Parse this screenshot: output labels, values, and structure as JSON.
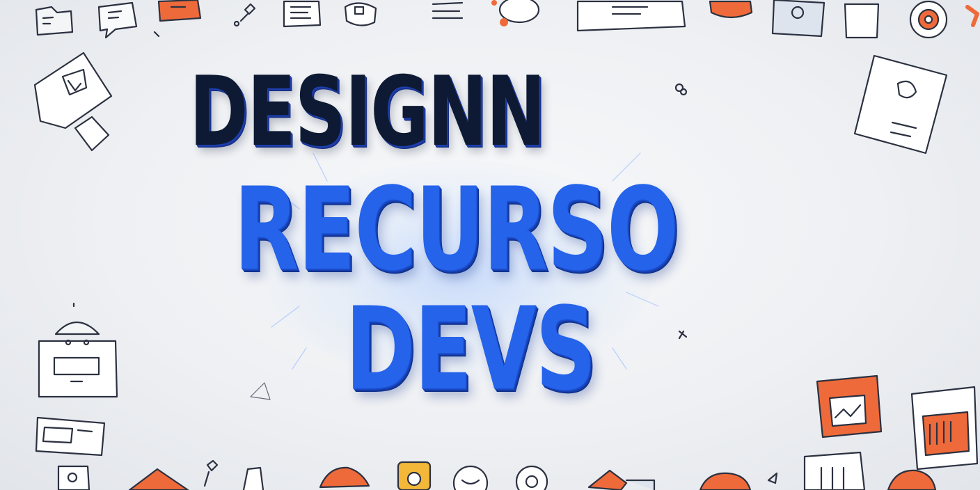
{
  "headline": {
    "line1": "DESIGNN",
    "line2": "RECURSO",
    "line3": "DEVS"
  },
  "colors": {
    "background": "#eef0f3",
    "line1_text": "#0e1a33",
    "accent_blue": "#2463ea",
    "doodle_ink": "#2b3140",
    "doodle_orange": "#ef6a3a",
    "doodle_yellow": "#f3b83a"
  },
  "decorations": [
    "image-icon",
    "document-icon",
    "robot-face-icon",
    "keyboard-icon",
    "chart-icon",
    "calendar-icon",
    "gear-icon",
    "chat-bubble-icon",
    "bug-icon",
    "home-icon",
    "pin-icon",
    "camera-icon",
    "folder-icon"
  ]
}
